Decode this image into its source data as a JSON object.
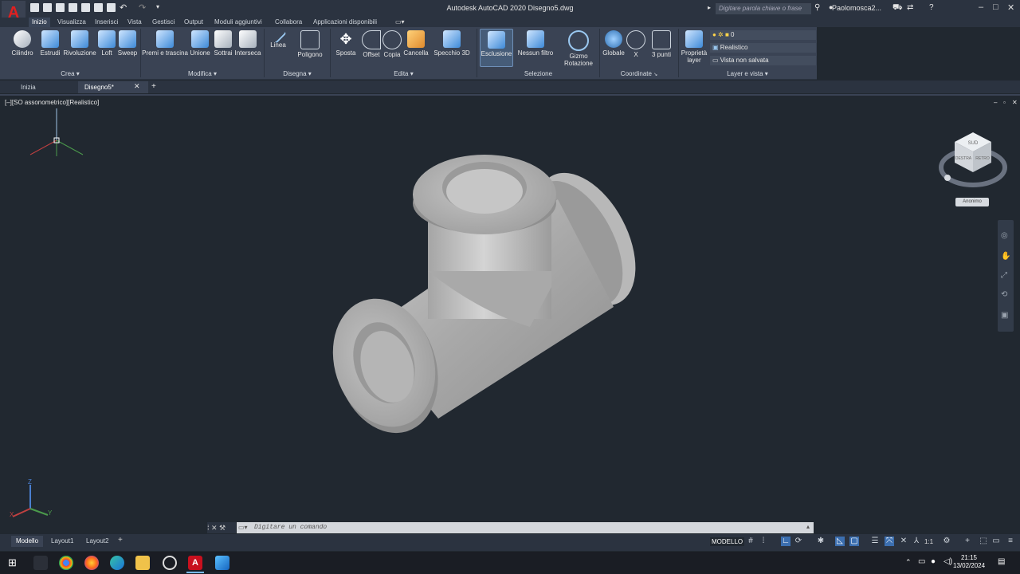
{
  "app": {
    "title": "Autodesk AutoCAD 2020    Disegno5.dwg",
    "search_placeholder": "Digitare parola chiave o frase",
    "user": "Paolomosca2...",
    "brand_color": "#e02020"
  },
  "ribbon_tabs": [
    "Inizio",
    "Visualizza",
    "Inserisci",
    "Vista",
    "Gestisci",
    "Output",
    "Moduli aggiuntivi",
    "Collabora",
    "Applicazioni disponibili"
  ],
  "ribbon_buttons": {
    "cilindro": "Cilindro",
    "estrudi": "Estrudi",
    "rivoluzione": "Rivoluzione",
    "loft": "Loft",
    "sweep": "Sweep",
    "premi": "Premi e trascina",
    "unione": "Unione",
    "sottrai": "Sottrai",
    "interseca": "Interseca",
    "linea": "Linea",
    "poligono": "Poligono",
    "sposta": "Sposta",
    "offset": "Offset",
    "copia": "Copia",
    "cancella": "Cancella",
    "specchio": "Specchio 3D",
    "esclusione": "Esclusione",
    "nessun_filtro": "Nessun filtro",
    "gizmo_1": "Gizmo",
    "gizmo_2": "Rotazione",
    "globale": "Globale",
    "x": "X",
    "tre_punti": "3 punti",
    "proprieta_1": "Proprietà",
    "proprieta_2": "layer"
  },
  "ribbon_panels": {
    "crea": "Crea",
    "modifica": "Modifica",
    "disegna": "Disegna",
    "edita": "Edita",
    "selezione": "Selezione",
    "coordinate": "Coordinate",
    "layer_vista": "Layer e vista"
  },
  "layer_rows": {
    "layer": "0",
    "visual_style": "Realistico",
    "view": "Vista non salvata"
  },
  "file_tabs": {
    "start": "Inizia",
    "drawing": "Disegno5*"
  },
  "viewport": {
    "label": "[–][SO assonometrico][Realistico]",
    "viewcube_faces": [
      "SUD",
      "DESTRA",
      "RETRO"
    ],
    "viewcube_label": "Anonimo"
  },
  "command": {
    "placeholder": "Digitare un comando"
  },
  "layout_tabs": [
    "Modello",
    "Layout1",
    "Layout2"
  ],
  "status": {
    "mode": "MODELLO",
    "scale": "1:1"
  },
  "taskbar": {
    "time": "21:15",
    "date": "13/02/2024"
  }
}
